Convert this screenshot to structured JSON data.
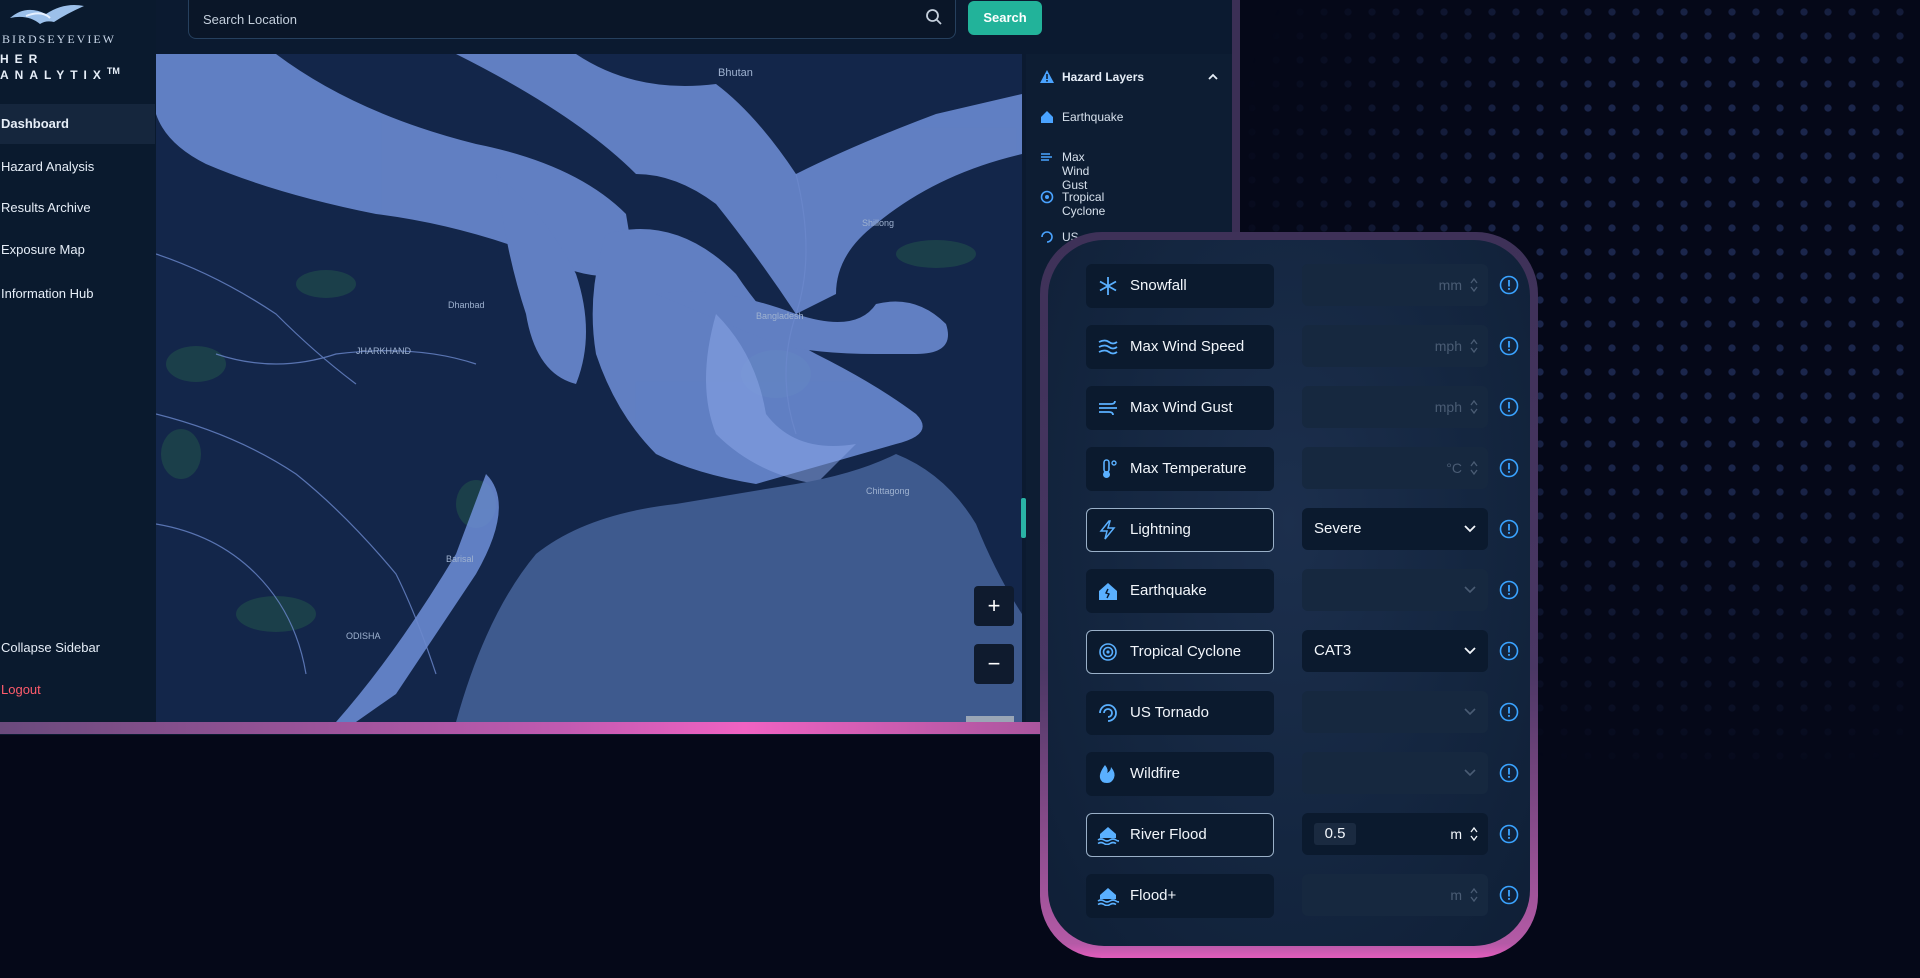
{
  "brand": {
    "line1": "BIRDSEYEVIEW",
    "line2": "HER ANALYTIX",
    "tm": "TM"
  },
  "nav": [
    {
      "label": "Dashboard"
    },
    {
      "label": "Hazard Analysis"
    },
    {
      "label": "Results Archive"
    },
    {
      "label": "Exposure Map"
    },
    {
      "label": "Information Hub"
    }
  ],
  "sidebar_footer": {
    "collapse": "Collapse Sidebar",
    "logout": "Logout"
  },
  "search": {
    "placeholder": "Search Location",
    "button": "Search"
  },
  "map": {
    "zoom_in": "+",
    "zoom_out": "−",
    "labels": [
      "Bhutan",
      "Dhanbad",
      "JHARKHAND",
      "ODISHA",
      "Barisal",
      "Chittagong",
      "Shillong",
      "Bangladesh"
    ]
  },
  "hazard_layers": {
    "title": "Hazard Layers",
    "items": [
      {
        "label": "Earthquake",
        "icon": "house-quake-icon"
      },
      {
        "label": "Max Wind Gust",
        "icon": "wind-gust-icon"
      },
      {
        "label": "Tropical Cyclone",
        "icon": "cyclone-icon"
      },
      {
        "label": "US Tornado",
        "icon": "tornado-icon"
      }
    ]
  },
  "hazard_settings": [
    {
      "label": "Snowfall",
      "icon": "snowflake-icon",
      "selected": false,
      "control": "number",
      "value": "",
      "unit": "mm"
    },
    {
      "label": "Max Wind Speed",
      "icon": "wind-icon",
      "selected": false,
      "control": "number",
      "value": "",
      "unit": "mph"
    },
    {
      "label": "Max Wind Gust",
      "icon": "wind-gust-icon",
      "selected": false,
      "control": "number",
      "value": "",
      "unit": "mph"
    },
    {
      "label": "Max Temperature",
      "icon": "thermometer-icon",
      "selected": false,
      "control": "number",
      "value": "",
      "unit": "°C"
    },
    {
      "label": "Lightning",
      "icon": "lightning-icon",
      "selected": true,
      "control": "select",
      "value": "Severe",
      "unit": ""
    },
    {
      "label": "Earthquake",
      "icon": "house-quake-icon",
      "selected": false,
      "control": "select",
      "value": "",
      "unit": ""
    },
    {
      "label": "Tropical Cyclone",
      "icon": "cyclone-icon",
      "selected": true,
      "control": "select",
      "value": "CAT3",
      "unit": ""
    },
    {
      "label": "US Tornado",
      "icon": "tornado-icon",
      "selected": false,
      "control": "select",
      "value": "",
      "unit": ""
    },
    {
      "label": "Wildfire",
      "icon": "fire-icon",
      "selected": false,
      "control": "select",
      "value": "",
      "unit": ""
    },
    {
      "label": "River Flood",
      "icon": "flood-house-icon",
      "selected": true,
      "control": "number",
      "value": "0.5",
      "unit": "m"
    },
    {
      "label": "Flood+",
      "icon": "flood-house-icon",
      "selected": false,
      "control": "number",
      "value": "",
      "unit": "m"
    }
  ],
  "colors": {
    "accent": "#22b39a",
    "info": "#3aa3ff",
    "logout": "#ff5c6c",
    "card_glow": "#e25cbc"
  }
}
